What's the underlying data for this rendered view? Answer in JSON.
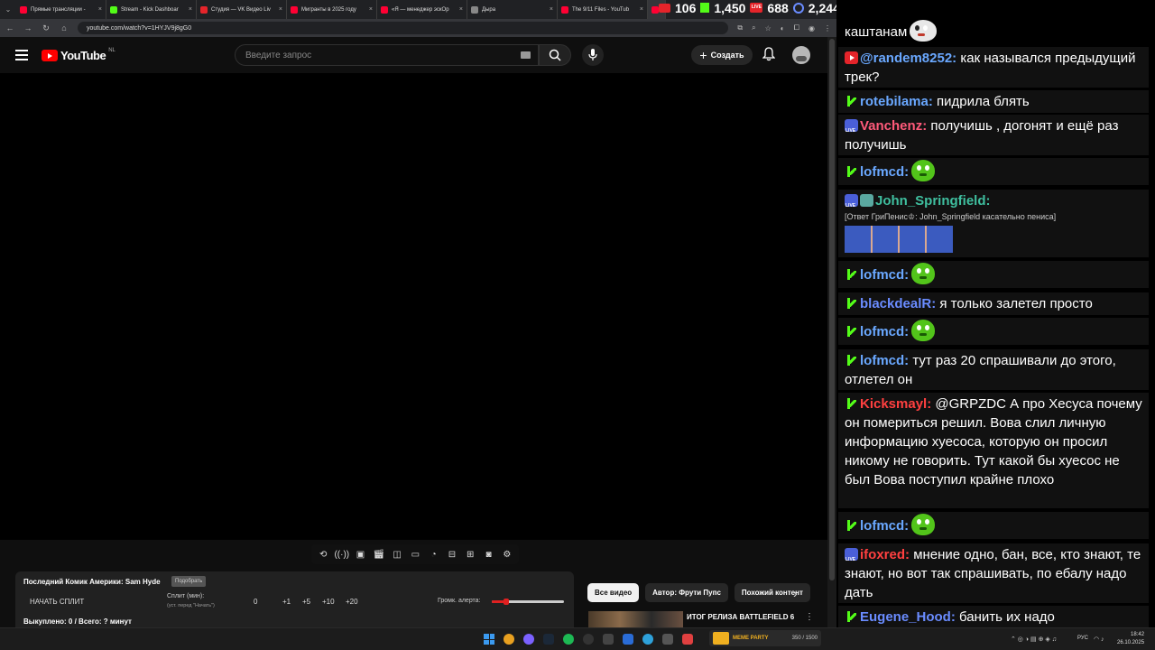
{
  "browser": {
    "tabs": [
      {
        "label": "Прямые трансляции -",
        "color": "#ff0033"
      },
      {
        "label": "Stream - Kick Dashboar",
        "color": "#53fc18"
      },
      {
        "label": "Студия — VK Видео Liv",
        "color": "#e5242a"
      },
      {
        "label": "Мигранты в 2025 году",
        "color": "#ff0033"
      },
      {
        "label": "«Я — менеджер эскОр",
        "color": "#ff0033"
      },
      {
        "label": "Дыра",
        "color": "#888888"
      },
      {
        "label": "The 9/11 Files - YouTub",
        "color": "#ff0033"
      }
    ],
    "url": "youtube.com/watch?v=1HYJV9j8gG0"
  },
  "stream_stats": {
    "youtube_viewers": "106",
    "kick_viewers": "1,450",
    "vk_viewers": "688",
    "total_viewers": "2,244"
  },
  "youtube": {
    "logo_text": "YouTube",
    "logo_region": "NL",
    "search_placeholder": "Введите запрос",
    "create_label": "Создать"
  },
  "split_panel": {
    "title": "Последний Комик Америки: Sam Hyde",
    "chip": "Подобрать",
    "start_label": "НАЧАТЬ СПЛИТ",
    "split_label": "Сплит (мин):",
    "split_hint": "(уст. перед \"Начать\")",
    "value": "0",
    "increments": [
      "+1",
      "+5",
      "+10",
      "+20"
    ],
    "alert_label": "Громк. алерта:",
    "alert_level": 0.2,
    "footer": "Выкуплено: 0 / Всего: ? минут"
  },
  "recommendations": {
    "chips": [
      "Все видео",
      "Автор: Фрути Пупс",
      "Похожий контент"
    ],
    "first_video_title": "ИТОГ РЕЛИЗА BATTLEFIELD 6"
  },
  "chat": {
    "messages": [
      {
        "text": "каштанам",
        "emote": "cat"
      },
      {
        "badge": "yt",
        "user": "@randem8252:",
        "user_color": "#6aa8ff",
        "text": "как назывался предыдущий трек?"
      },
      {
        "badge": "kick",
        "user": "rotebilama:",
        "user_color": "#6aa8ff",
        "text": "пидрила блять"
      },
      {
        "badge": "vk",
        "user": "Vanchenz:",
        "user_color": "#ff5a7a",
        "text": "получишь , догонят и ещё раз получишь"
      },
      {
        "badge": "kick",
        "user": "lofmcd:",
        "user_color": "#6aa8ff",
        "emote": "green"
      },
      {
        "badge": "vk",
        "user": "John_Springfield:",
        "user_color": "#3fbf9f",
        "reply": "[Ответ ГриПенис♔: John_Springfield касательно пениса]"
      },
      {
        "badge": "kick",
        "user": "lofmcd:",
        "user_color": "#6aa8ff",
        "emote": "green"
      },
      {
        "badge": "kick",
        "user": "blackdealR:",
        "user_color": "#6a8cff",
        "text": "я только залетел просто"
      },
      {
        "badge": "kick",
        "user": "lofmcd:",
        "user_color": "#6aa8ff",
        "emote": "green"
      },
      {
        "badge": "kick",
        "user": "lofmcd:",
        "user_color": "#6aa8ff",
        "text": "тут раз 20 спрашивали до этого, отлетел он"
      },
      {
        "badge": "kick",
        "user": "Kicksmayl:",
        "user_color": "#ff4040",
        "text": "@GRPZDC А про Хесуса почему он помериться решил. Вова слил личную информацию хуесоса, которую он просил никому не говорить. Тут какой бы хуесос не был Вова поступил крайне плохо"
      },
      {
        "badge": "kick",
        "user": "lofmcd:",
        "user_color": "#6aa8ff",
        "emote": "green"
      },
      {
        "badge": "vk",
        "user": "ifoxred:",
        "user_color": "#ff4040",
        "text": "мнение одно, бан, все, кто знают, те знают, но вот так спрашивать, по ебалу надо дать"
      },
      {
        "badge": "kick",
        "user": "Eugene_Hood:",
        "user_color": "#6a8cff",
        "text": "банить их надо"
      }
    ]
  },
  "taskbar": {
    "game_label": "МЕМЕ PARTY",
    "game_progress": "350 / 1500",
    "lang": "РУС",
    "time": "18:42",
    "date": "26.10.2025"
  }
}
